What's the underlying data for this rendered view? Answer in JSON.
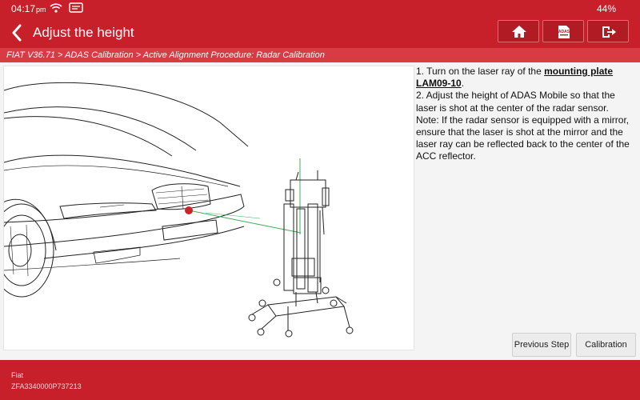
{
  "status": {
    "time": "04:17",
    "period": "pm",
    "battery": "44%",
    "icons": [
      "wifi-icon",
      "mail-icon"
    ]
  },
  "header": {
    "title": "Adjust the height",
    "buttons": [
      "home-icon",
      "adas-icon",
      "exit-icon"
    ],
    "adas_icon_text": "ADAS"
  },
  "breadcrumb": "FIAT V36.71 > ADAS Calibration > Active Alignment Procedure: Radar Calibration",
  "instructions": {
    "step1_prefix": "1. Turn on the laser ray of the ",
    "step1_link": "mounting plate LAM09-10",
    "step1_suffix": ".",
    "step2": "2. Adjust the height of ADAS Mobile so that the laser is shot at the center of the radar sensor.",
    "note": "Note: If the radar sensor is equipped with a mirror, ensure that the laser is shot at the mirror and the laser ray can be reflected back to the center of the ACC reflector."
  },
  "buttons": {
    "previous": "Previous Step",
    "calibration": "Calibration"
  },
  "footer": {
    "make": "Fiat",
    "vin": "ZFA3340000P737213"
  },
  "colors": {
    "brand_red": "#c8202b",
    "breadcrumb_red": "#d83b44",
    "laser_green": "#3fae5c",
    "sensor_red": "#d0202a"
  }
}
